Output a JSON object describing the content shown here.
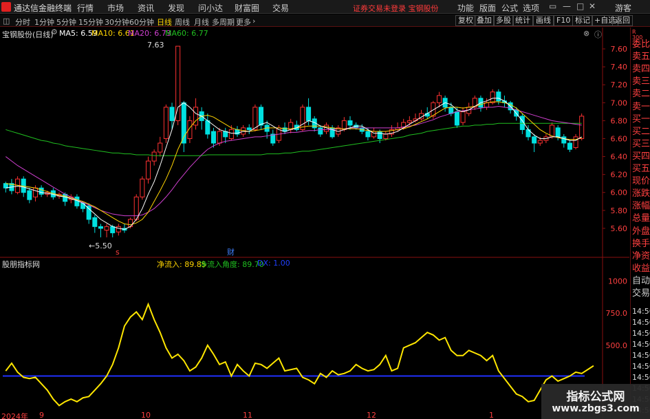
{
  "app": {
    "title": "通达信金融终端"
  },
  "menu": [
    "行情",
    "市场",
    "资讯",
    "发现",
    "问小达",
    "财富圈",
    "交易"
  ],
  "notice": "证券交易未登录  宝钢股份",
  "right_menu": [
    "功能",
    "版面",
    "公式",
    "选项"
  ],
  "user": "游客",
  "window_buttons": [
    "▭",
    "—",
    "□",
    "✕"
  ],
  "periods": [
    "分时",
    "1分钟",
    "5分钟",
    "15分钟",
    "30分钟",
    "60分钟",
    "日线",
    "周线",
    "月线",
    "多周期",
    "更多"
  ],
  "active_period": "日线",
  "tool_buttons": [
    "复权",
    "叠加",
    "多股",
    "统计",
    "画线",
    "F10",
    "标记",
    "+自选",
    "返回"
  ],
  "main": {
    "stock_label": "宝钢股份(日线)",
    "ma5": "MA5: 6.59",
    "ma10": "MA10: 6.61",
    "ma20": "MA20: 6.73",
    "ma60": "MA60: 6.77",
    "max_label": "7.63",
    "min_label": "←5.50",
    "marker_s": "s",
    "marker_cai": "财",
    "colors": {
      "up": "#ff3232",
      "down": "#00e0e0",
      "ma5": "#ffffff",
      "ma10": "#ffd400",
      "ma20": "#d040d0",
      "ma60": "#20c020"
    }
  },
  "sub": {
    "indicator": "股朋指标网",
    "inflow": "净流入: 89.85",
    "angle": "净流入角度: 89.70",
    "dx": "DX: 1.00"
  },
  "y_axis_main": [
    "7.60",
    "7.40",
    "7.20",
    "7.00",
    "6.80",
    "6.60",
    "6.40",
    "6.20",
    "6.00",
    "5.80",
    "5.60"
  ],
  "y_axis_sub": [
    "1000",
    "750.0",
    "500.0"
  ],
  "x_axis": [
    "2024年",
    "9",
    "10",
    "11",
    "12",
    "1"
  ],
  "side": {
    "top_label": "R",
    "top_code": "300",
    "items": [
      "委比",
      "卖五",
      "卖四",
      "卖三",
      "卖二",
      "卖一",
      "买一",
      "买二",
      "买三",
      "买四",
      "买五",
      "现价",
      "涨跌",
      "涨幅",
      "总量",
      "外盘",
      "换手",
      "净资",
      "收益",
      "自动",
      "交易"
    ],
    "times": [
      "14:56",
      "14:56",
      "14:56",
      "14:56",
      "14:56",
      "14:56",
      "14:56",
      "14:56",
      "14:56",
      "14:56"
    ]
  },
  "watermark": {
    "title": "指标公式网",
    "url": "www.zbgs3.com"
  },
  "chart_data": {
    "type": "candlestick",
    "ylim": [
      5.4,
      7.7
    ],
    "candles": [
      [
        6.05,
        6.1,
        6.0,
        6.12,
        "d"
      ],
      [
        6.1,
        6.02,
        5.98,
        6.15,
        "d"
      ],
      [
        6.0,
        6.15,
        5.98,
        6.18,
        "u"
      ],
      [
        6.15,
        6.0,
        5.95,
        6.18,
        "d"
      ],
      [
        6.02,
        5.92,
        5.88,
        6.05,
        "d"
      ],
      [
        5.95,
        6.05,
        5.9,
        6.08,
        "u"
      ],
      [
        6.05,
        5.98,
        5.95,
        6.08,
        "d"
      ],
      [
        5.98,
        6.0,
        5.95,
        6.02,
        "u"
      ],
      [
        6.02,
        5.95,
        5.92,
        6.05,
        "d"
      ],
      [
        5.96,
        5.98,
        5.93,
        6.0,
        "u"
      ],
      [
        5.98,
        5.9,
        5.85,
        6.0,
        "d"
      ],
      [
        5.92,
        5.95,
        5.88,
        5.98,
        "u"
      ],
      [
        5.95,
        5.85,
        5.82,
        5.98,
        "d"
      ],
      [
        5.88,
        5.82,
        5.78,
        5.9,
        "d"
      ],
      [
        5.85,
        5.7,
        5.65,
        5.88,
        "d"
      ],
      [
        5.72,
        5.62,
        5.55,
        5.75,
        "d"
      ],
      [
        5.62,
        5.6,
        5.5,
        5.65,
        "d"
      ],
      [
        5.58,
        5.62,
        5.5,
        5.65,
        "u"
      ],
      [
        5.62,
        5.55,
        5.5,
        5.64,
        "d"
      ],
      [
        5.56,
        5.62,
        5.52,
        5.65,
        "u"
      ],
      [
        5.6,
        5.58,
        5.55,
        5.65,
        "d"
      ],
      [
        5.62,
        5.7,
        5.6,
        5.72,
        "u"
      ],
      [
        5.7,
        5.95,
        5.68,
        5.98,
        "u"
      ],
      [
        5.95,
        6.15,
        5.92,
        6.18,
        "u"
      ],
      [
        6.15,
        6.35,
        6.1,
        6.4,
        "u"
      ],
      [
        6.35,
        6.45,
        6.3,
        6.48,
        "u"
      ],
      [
        6.45,
        6.55,
        6.4,
        6.62,
        "u"
      ],
      [
        6.6,
        6.95,
        6.55,
        6.98,
        "u"
      ],
      [
        6.95,
        6.8,
        6.7,
        7.0,
        "d"
      ],
      [
        6.8,
        7.63,
        6.75,
        7.63,
        "u"
      ],
      [
        7.0,
        6.55,
        6.45,
        7.02,
        "d"
      ],
      [
        6.6,
        6.8,
        6.55,
        6.85,
        "u"
      ],
      [
        6.75,
        6.95,
        6.7,
        7.05,
        "u"
      ],
      [
        6.9,
        6.8,
        6.7,
        6.95,
        "d"
      ],
      [
        6.8,
        6.65,
        6.6,
        6.88,
        "d"
      ],
      [
        6.68,
        6.55,
        6.5,
        6.72,
        "d"
      ],
      [
        6.55,
        6.68,
        6.52,
        6.72,
        "u"
      ],
      [
        6.68,
        6.62,
        6.55,
        6.72,
        "d"
      ],
      [
        6.6,
        6.7,
        6.58,
        6.75,
        "u"
      ],
      [
        6.7,
        6.65,
        6.62,
        6.74,
        "d"
      ],
      [
        6.65,
        6.72,
        6.62,
        6.75,
        "u"
      ],
      [
        6.72,
        6.7,
        6.65,
        6.76,
        "d"
      ],
      [
        6.7,
        6.95,
        6.68,
        6.98,
        "u"
      ],
      [
        6.95,
        6.75,
        6.7,
        6.98,
        "d"
      ],
      [
        6.75,
        6.68,
        6.6,
        6.8,
        "d"
      ],
      [
        6.65,
        6.55,
        6.52,
        6.7,
        "d"
      ],
      [
        6.58,
        6.72,
        6.55,
        6.75,
        "u"
      ],
      [
        6.72,
        6.68,
        6.65,
        6.78,
        "d"
      ],
      [
        6.7,
        6.78,
        6.66,
        6.82,
        "u"
      ],
      [
        6.75,
        6.7,
        6.68,
        6.8,
        "d"
      ],
      [
        6.7,
        6.95,
        6.68,
        6.98,
        "u"
      ],
      [
        6.95,
        6.8,
        6.75,
        7.05,
        "d"
      ],
      [
        6.82,
        6.72,
        6.68,
        6.85,
        "d"
      ],
      [
        6.72,
        6.65,
        6.62,
        6.75,
        "d"
      ],
      [
        6.68,
        6.75,
        6.65,
        6.78,
        "u"
      ],
      [
        6.72,
        6.62,
        6.6,
        6.75,
        "d"
      ],
      [
        6.65,
        6.72,
        6.62,
        6.75,
        "u"
      ],
      [
        6.7,
        6.8,
        6.68,
        6.84,
        "u"
      ],
      [
        6.8,
        6.75,
        6.7,
        6.85,
        "d"
      ],
      [
        6.75,
        6.72,
        6.7,
        6.78,
        "d"
      ],
      [
        6.72,
        6.68,
        6.65,
        6.76,
        "d"
      ],
      [
        6.68,
        6.62,
        6.58,
        6.72,
        "d"
      ],
      [
        6.62,
        6.68,
        6.6,
        6.72,
        "u"
      ],
      [
        6.68,
        6.6,
        6.55,
        6.7,
        "d"
      ],
      [
        6.6,
        6.65,
        6.58,
        6.68,
        "u"
      ],
      [
        6.65,
        6.7,
        6.62,
        6.75,
        "u"
      ],
      [
        6.7,
        6.72,
        6.68,
        6.78,
        "u"
      ],
      [
        6.72,
        6.78,
        6.7,
        6.82,
        "u"
      ],
      [
        6.78,
        6.8,
        6.75,
        6.85,
        "u"
      ],
      [
        6.8,
        6.82,
        6.78,
        6.88,
        "u"
      ],
      [
        6.82,
        6.88,
        6.8,
        6.92,
        "u"
      ],
      [
        6.88,
        6.85,
        6.82,
        6.95,
        "d"
      ],
      [
        6.85,
        7.0,
        6.82,
        7.02,
        "u"
      ],
      [
        7.0,
        7.08,
        6.95,
        7.12,
        "u"
      ],
      [
        7.05,
        6.95,
        6.9,
        7.08,
        "d"
      ],
      [
        6.95,
        6.88,
        6.85,
        7.0,
        "d"
      ],
      [
        6.9,
        6.75,
        6.72,
        6.95,
        "d"
      ],
      [
        6.78,
        6.9,
        6.75,
        6.95,
        "u"
      ],
      [
        6.88,
        6.95,
        6.85,
        7.0,
        "u"
      ],
      [
        6.95,
        7.05,
        6.92,
        7.08,
        "u"
      ],
      [
        7.05,
        6.95,
        6.9,
        7.08,
        "d"
      ],
      [
        6.95,
        7.0,
        6.92,
        7.05,
        "u"
      ],
      [
        7.0,
        7.12,
        6.98,
        7.15,
        "u"
      ],
      [
        7.12,
        7.02,
        6.98,
        7.15,
        "d"
      ],
      [
        7.02,
        7.0,
        6.95,
        7.08,
        "d"
      ],
      [
        7.0,
        6.92,
        6.88,
        7.02,
        "d"
      ],
      [
        6.92,
        6.85,
        6.8,
        6.95,
        "d"
      ],
      [
        6.85,
        6.7,
        6.65,
        6.88,
        "d"
      ],
      [
        6.7,
        6.62,
        6.58,
        6.75,
        "d"
      ],
      [
        6.62,
        6.55,
        6.45,
        6.65,
        "d"
      ],
      [
        6.55,
        6.58,
        6.52,
        6.62,
        "u"
      ],
      [
        6.58,
        6.62,
        6.55,
        6.65,
        "u"
      ],
      [
        6.62,
        6.75,
        6.6,
        6.78,
        "u"
      ],
      [
        6.72,
        6.62,
        6.58,
        6.75,
        "d"
      ],
      [
        6.62,
        6.55,
        6.5,
        6.65,
        "d"
      ],
      [
        6.55,
        6.48,
        6.45,
        6.58,
        "d"
      ],
      [
        6.5,
        6.62,
        6.48,
        6.65,
        "u"
      ],
      [
        6.6,
        6.85,
        6.58,
        6.88,
        "u"
      ]
    ],
    "ma5": [
      6.05,
      6.06,
      6.07,
      6.06,
      6.04,
      6.02,
      6.0,
      5.99,
      5.98,
      5.96,
      5.95,
      5.93,
      5.91,
      5.88,
      5.82,
      5.76,
      5.7,
      5.66,
      5.62,
      5.6,
      5.59,
      5.62,
      5.7,
      5.82,
      5.98,
      6.12,
      6.3,
      6.5,
      6.7,
      6.95,
      7.0,
      6.95,
      6.88,
      6.85,
      6.8,
      6.75,
      6.7,
      6.68,
      6.66,
      6.66,
      6.68,
      6.68,
      6.72,
      6.76,
      6.78,
      6.74,
      6.7,
      6.68,
      6.7,
      6.72,
      6.76,
      6.8,
      6.78,
      6.74,
      6.72,
      6.7,
      6.68,
      6.7,
      6.72,
      6.74,
      6.74,
      6.7,
      6.66,
      6.66,
      6.65,
      6.66,
      6.68,
      6.72,
      6.76,
      6.8,
      6.84,
      6.88,
      6.92,
      6.96,
      7.0,
      6.98,
      6.92,
      6.9,
      6.92,
      6.96,
      7.0,
      7.02,
      7.05,
      7.05,
      7.02,
      6.96,
      6.88,
      6.8,
      6.7,
      6.64,
      6.6,
      6.6,
      6.62,
      6.62,
      6.6,
      6.58,
      6.58,
      6.62
    ],
    "ma10": [
      6.1,
      6.09,
      6.08,
      6.07,
      6.06,
      6.05,
      6.03,
      6.01,
      5.99,
      5.97,
      5.96,
      5.94,
      5.92,
      5.9,
      5.87,
      5.84,
      5.8,
      5.76,
      5.72,
      5.68,
      5.65,
      5.64,
      5.66,
      5.7,
      5.78,
      5.9,
      6.02,
      6.15,
      6.3,
      6.48,
      6.62,
      6.72,
      6.8,
      6.85,
      6.86,
      6.84,
      6.8,
      6.76,
      6.72,
      6.7,
      6.69,
      6.68,
      6.69,
      6.7,
      6.72,
      6.72,
      6.72,
      6.71,
      6.71,
      6.72,
      6.73,
      6.74,
      6.74,
      6.74,
      6.73,
      6.72,
      6.71,
      6.71,
      6.71,
      6.71,
      6.7,
      6.69,
      6.68,
      6.68,
      6.68,
      6.69,
      6.7,
      6.71,
      6.73,
      6.76,
      6.79,
      6.82,
      6.86,
      6.9,
      6.94,
      6.95,
      6.95,
      6.94,
      6.95,
      6.96,
      6.98,
      7.0,
      7.01,
      7.01,
      7.0,
      6.98,
      6.94,
      6.88,
      6.82,
      6.76,
      6.7,
      6.66,
      6.63,
      6.61,
      6.6,
      6.59,
      6.59,
      6.61
    ],
    "ma20": [
      6.4,
      6.35,
      6.3,
      6.26,
      6.22,
      6.18,
      6.14,
      6.1,
      6.06,
      6.02,
      5.98,
      5.95,
      5.92,
      5.89,
      5.86,
      5.83,
      5.8,
      5.78,
      5.76,
      5.75,
      5.74,
      5.74,
      5.74,
      5.75,
      5.78,
      5.82,
      5.88,
      5.95,
      6.03,
      6.12,
      6.2,
      6.28,
      6.35,
      6.42,
      6.48,
      6.52,
      6.55,
      6.57,
      6.58,
      6.59,
      6.6,
      6.61,
      6.62,
      6.62,
      6.63,
      6.64,
      6.65,
      6.66,
      6.67,
      6.67,
      6.68,
      6.69,
      6.69,
      6.7,
      6.7,
      6.7,
      6.71,
      6.71,
      6.72,
      6.72,
      6.72,
      6.72,
      6.72,
      6.72,
      6.72,
      6.72,
      6.72,
      6.73,
      6.74,
      6.75,
      6.77,
      6.79,
      6.81,
      6.84,
      6.86,
      6.88,
      6.9,
      6.91,
      6.92,
      6.93,
      6.94,
      6.95,
      6.95,
      6.96,
      6.95,
      6.94,
      6.92,
      6.9,
      6.88,
      6.86,
      6.84,
      6.82,
      6.8,
      6.79,
      6.78,
      6.77,
      6.76,
      6.75
    ],
    "ma60": [
      6.7,
      6.68,
      6.66,
      6.64,
      6.62,
      6.6,
      6.58,
      6.57,
      6.55,
      6.54,
      6.52,
      6.51,
      6.5,
      6.49,
      6.48,
      6.47,
      6.46,
      6.45,
      6.44,
      6.44,
      6.43,
      6.43,
      6.42,
      6.42,
      6.42,
      6.41,
      6.41,
      6.41,
      6.41,
      6.41,
      6.41,
      6.41,
      6.41,
      6.41,
      6.42,
      6.42,
      6.42,
      6.42,
      6.42,
      6.42,
      6.42,
      6.42,
      6.42,
      6.42,
      6.43,
      6.43,
      6.43,
      6.44,
      6.44,
      6.45,
      6.46,
      6.46,
      6.47,
      6.48,
      6.49,
      6.5,
      6.51,
      6.52,
      6.53,
      6.54,
      6.55,
      6.56,
      6.57,
      6.58,
      6.59,
      6.6,
      6.61,
      6.62,
      6.64,
      6.65,
      6.66,
      6.68,
      6.69,
      6.7,
      6.71,
      6.72,
      6.73,
      6.74,
      6.74,
      6.75,
      6.75,
      6.76,
      6.76,
      6.77,
      6.77,
      6.77,
      6.77,
      6.77,
      6.77,
      6.77,
      6.77,
      6.77,
      6.77,
      6.77,
      6.77,
      6.77,
      6.77,
      6.77
    ],
    "indicator": [
      300,
      360,
      290,
      250,
      240,
      250,
      200,
      150,
      80,
      30,
      60,
      80,
      60,
      90,
      100,
      150,
      200,
      260,
      350,
      480,
      650,
      720,
      760,
      700,
      820,
      700,
      600,
      480,
      400,
      430,
      380,
      300,
      330,
      400,
      500,
      430,
      350,
      370,
      260,
      350,
      300,
      260,
      360,
      350,
      320,
      360,
      400,
      300,
      310,
      320,
      250,
      230,
      200,
      280,
      250,
      300,
      270,
      280,
      300,
      350,
      320,
      300,
      310,
      350,
      420,
      300,
      320,
      480,
      500,
      520,
      560,
      600,
      580,
      540,
      560,
      460,
      420,
      420,
      460,
      440,
      420,
      380,
      420,
      300,
      240,
      180,
      120,
      100,
      60,
      70,
      150,
      230,
      260,
      220,
      240,
      260,
      290,
      280,
      310,
      340
    ],
    "baseline": 260,
    "sub_ylim": [
      0,
      1100
    ]
  }
}
